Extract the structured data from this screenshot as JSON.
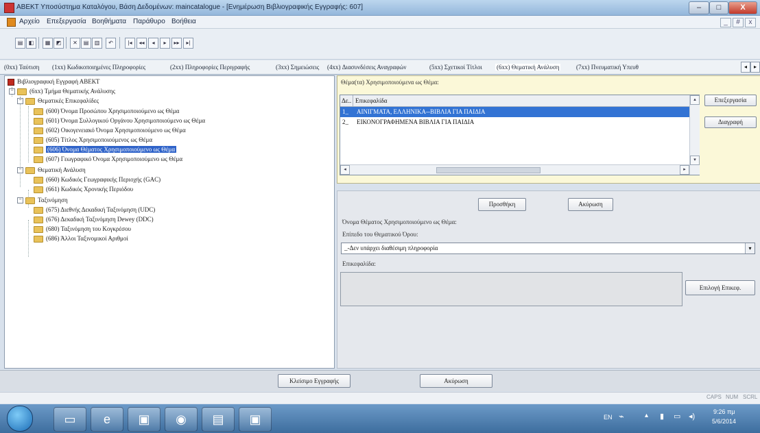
{
  "window": {
    "title": "ΑΒΕΚΤ Υποσύστημα Καταλόγου, Βάση Δεδομένων: maincatalogue - [Ενημέρωση Βιβλιογραφικής Εγγραφής: 607]",
    "minimize": "–",
    "maximize": "□",
    "close": "X"
  },
  "menu": {
    "items": [
      "Αρχείο",
      "Επεξεργασία",
      "Βοηθήματα",
      "Παράθυρο",
      "Βοήθεια"
    ],
    "mdi": [
      "_",
      "#",
      "x"
    ]
  },
  "toolbar": {
    "buttons": [
      "▤",
      "◧",
      "▦",
      "◩",
      "✕",
      "▤",
      "▥",
      "↶",
      "|◂",
      "◂◂",
      "◂",
      "▸",
      "▸▸",
      "▸|"
    ]
  },
  "tabs": [
    "(0xx) Ταύτιση",
    "(1xx) Κωδικοποιημένες Πληροφορίες",
    "(2xx) Πληροφορίες Περιγραφής",
    "(3xx) Σημειώσεις",
    "(4xx) Διασυνδέσεις Αναγραφών",
    "(5xx) Σχετικοί Τίτλοι",
    "(6xx) Θεματική Ανάλυση",
    "(7xx) Πνευματική Υπευθ"
  ],
  "tree": {
    "root": "Βιβλιογραφική Εγγραφή ΑΒΕΚΤ",
    "block": "(6xx) Τμήμα Θεματικής Ανάλυσης",
    "group1": "Θεματικές Επικεφαλίδες",
    "group1_items": [
      "(600) Όνομα Προσώπου Χρησιμοποιούμενο ως Θέμα",
      "(601) Όνομα Συλλογικού Οργάνου Χρησιμοποιούμενο ως Θέμα",
      "(602) Οικογενειακό Όνομα Χρησιμοποιούμενο ως Θέμα",
      "(605) Τίτλος Χρησιμοποιούμενος ως Θέμα",
      "(606) Όνομα Θέματος Χρησιμοποιούμενο ως Θέμα",
      "(607) Γεωγραφικό Όνομα Χρησιμοποιούμενο ως Θέμα"
    ],
    "group2": "Θεματική Ανάλυση",
    "group2_items": [
      "(660) Κωδικός Γεωγραφικής Περιοχής (GAC)",
      "(661) Κωδικός Χρονικής Περιόδου"
    ],
    "group3": "Ταξινόμηση",
    "group3_items": [
      "(675) Διεθνής Δεκαδική Ταξινόμηση (UDC)",
      "(676) Δεκαδική Ταξινόμηση Dewey (DDC)",
      "(680) Ταξινόμηση του Κογκρέσου",
      "(686) Άλλοι Ταξινομικοί Αριθμοί"
    ]
  },
  "subjects": {
    "legend": "Θέμα(τα) Χρησιμοποιούμενα ως Θέμα:",
    "col_num": "Δε..",
    "col_heading": "Επικεφαλίδα",
    "rows": [
      {
        "num": "1_",
        "text": "ΑΙΝΙΓΜΑΤΑ, ΕΛΛΗΝΙΚΑ--ΒΙΒΛΙΑ ΓΙΑ ΠΑΙΔΙΑ"
      },
      {
        "num": "2_",
        "text": "ΕΙΚΟΝΟΓΡΑΦΗΜΕΝΑ ΒΙΒΛΙΑ ΓΙΑ ΠΑΙΔΙΑ"
      }
    ],
    "edit_button": "Επεξεργασία",
    "delete_button": "Διαγραφή"
  },
  "form": {
    "add_button": "Προσθήκη",
    "cancel_button": "Ακύρωση",
    "section_label": "Όνομα Θέματος Χρησιμοποιούμενο ως Θέμα:",
    "level_label": "Επίπεδο του Θεματικού Όρου:",
    "level_value": "_-Δεν υπάρχει διαθέσιμη πληροφορία",
    "heading_label": "Επικεφαλίδα:",
    "select_heading_button": "Επιλογή Επικεφ."
  },
  "bottom": {
    "close_record": "Κλείσιμο Εγγραφής",
    "cancel": "Ακύρωση"
  },
  "status": {
    "caps": "CAPS",
    "num": "NUM",
    "scrl": "SCRL"
  },
  "taskbar": {
    "lang": "EN",
    "time": "9:26 πμ",
    "date": "5/6/2014"
  }
}
